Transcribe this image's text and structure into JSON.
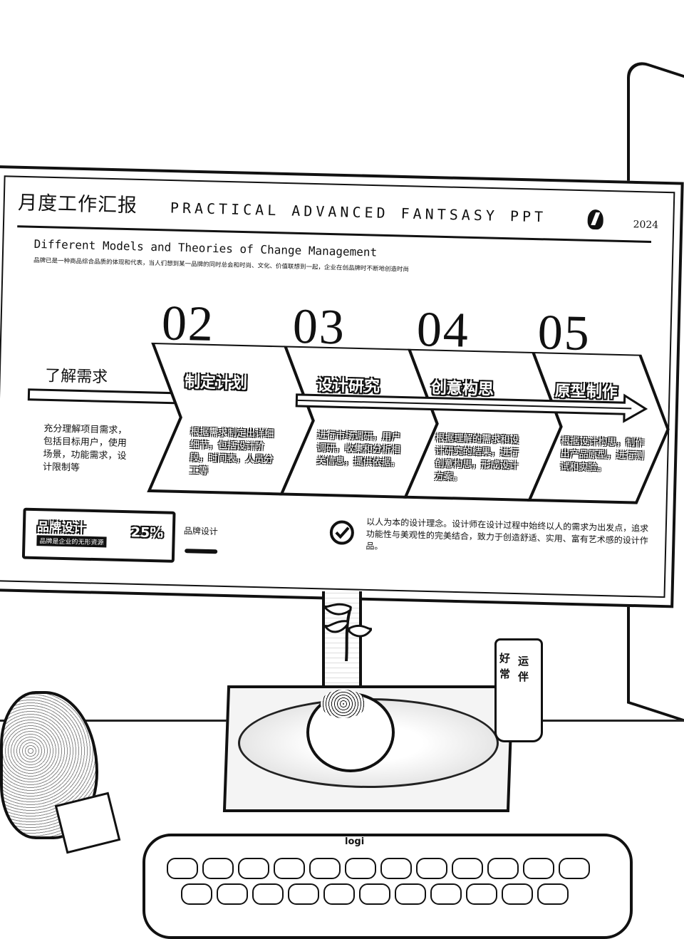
{
  "slide": {
    "title_cn": "月度工作汇报",
    "title_en": "PRACTICAL ADVANCED FANTSASY PPT",
    "year": "2024",
    "subtitle": "Different Models and Theories of Change Management",
    "description": "品牌已是一种商品综合品质的体现和代表，当人们想到某一品牌的同时总会和时尚、文化、价值联想到一起，企业在创品牌时不断地创造时尚",
    "steps": [
      {
        "number": "",
        "title": "了解需求",
        "text": "充分理解项目需求，包括目标用户，使用场景，功能需求，设计限制等"
      },
      {
        "number": "02",
        "title": "制定计划",
        "text": "根据需求制定出详细细节，包括设计阶段，时间表，人员分工等"
      },
      {
        "number": "03",
        "title": "设计研究",
        "text": "进行市场调研，用户调研，收集和分析相关信息，提供依据。"
      },
      {
        "number": "04",
        "title": "创意构思",
        "text": "根据理解的需求和设计研究的结果，进行创意构思，形成设计方案。"
      },
      {
        "number": "05",
        "title": "原型制作",
        "text": "根据设计构思，制作出产品原型，进行测试和实验。"
      }
    ],
    "brand_card": {
      "title": "品牌设计",
      "subtitle": "品牌是企业的无形资源",
      "percent": "25%"
    },
    "brand_label": "品牌设计",
    "concept_text": "以人为本的设计理念。设计师在设计过程中始终以人的需求为出发点，追求功能性与美观性的完美结合，致力于创造舒适、实用、富有艺术感的设计作品。"
  },
  "scene": {
    "cup_text": [
      "好",
      "运",
      "常",
      "伴"
    ],
    "keyboard_brand": "logi"
  }
}
